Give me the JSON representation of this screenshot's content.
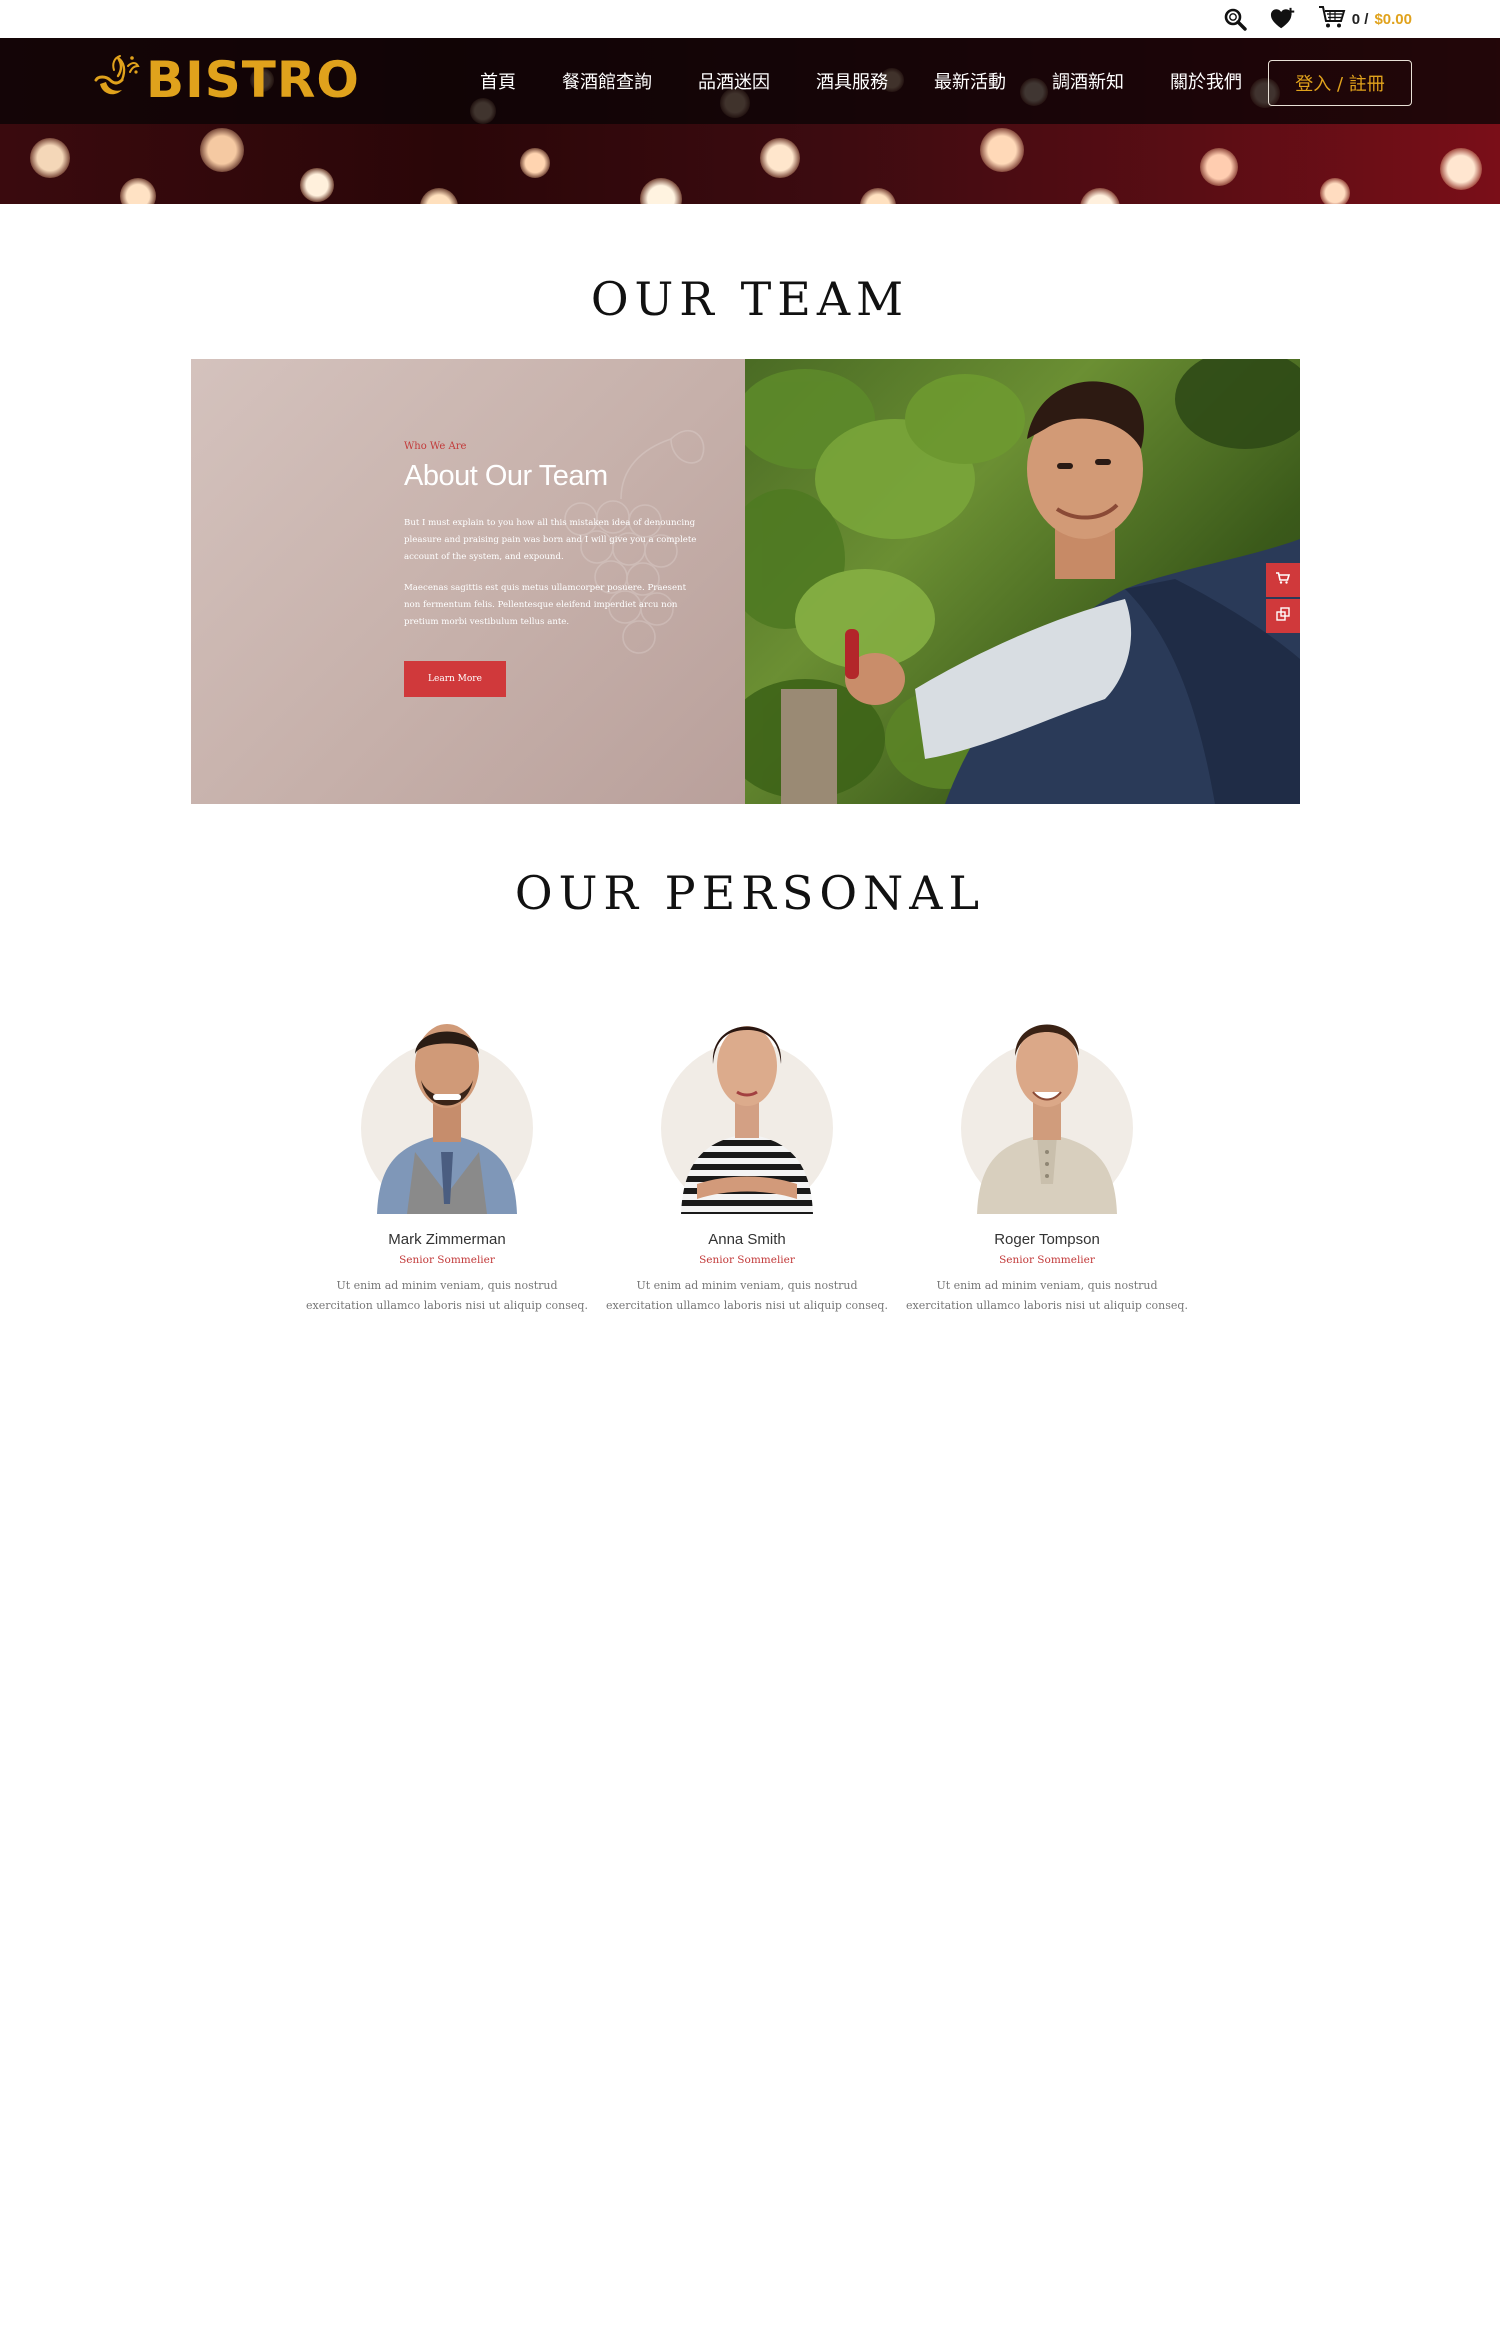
{
  "header": {
    "cart_count": "0 /",
    "cart_total": "$0.00",
    "logo_text": "BISTRO",
    "nav": [
      "首頁",
      "餐酒館查詢",
      "品酒迷因",
      "酒具服務",
      "最新活動",
      "調酒新知",
      "關於我們"
    ],
    "login_label": "登入 / 註冊"
  },
  "sections": {
    "team_title": "OUR TEAM",
    "personal_title": "OUR PERSONAL"
  },
  "team": {
    "eyebrow": "Who We Are",
    "heading": "About Our Team",
    "para1": "But I must explain to you how all this mistaken idea of denouncing pleasure and praising pain was born and I will give you a complete account of the system, and expound.",
    "para2": "Maecenas sagittis est quis metus ullamcorper posuere. Praesent non fermentum felis. Pellentesque eleifend imperdiet arcu non pretium morbi vestibulum tellus ante.",
    "button": "Learn More"
  },
  "personal": [
    {
      "name": "Mark Zimmerman",
      "role": "Senior Sommelier",
      "bio": "Ut enim ad minim veniam, quis nostrud exercitation ullamco laboris nisi ut aliquip conseq."
    },
    {
      "name": "Anna Smith",
      "role": "Senior Sommelier",
      "bio": "Ut enim ad minim veniam, quis nostrud exercitation ullamco laboris nisi ut aliquip conseq."
    },
    {
      "name": "Roger Tompson",
      "role": "Senior Sommelier",
      "bio": "Ut enim ad minim veniam, quis nostrud exercitation ullamco laboris nisi ut aliquip conseq."
    }
  ],
  "colors": {
    "accent_gold": "#e0a21c",
    "accent_red": "#d0393b",
    "team_panel": "#c6b0aa"
  },
  "icons": {
    "search": "search-icon",
    "wishlist": "heart-plus-icon",
    "cart": "cart-icon",
    "side_cart": "cart-icon",
    "side_compare": "compare-icon"
  }
}
